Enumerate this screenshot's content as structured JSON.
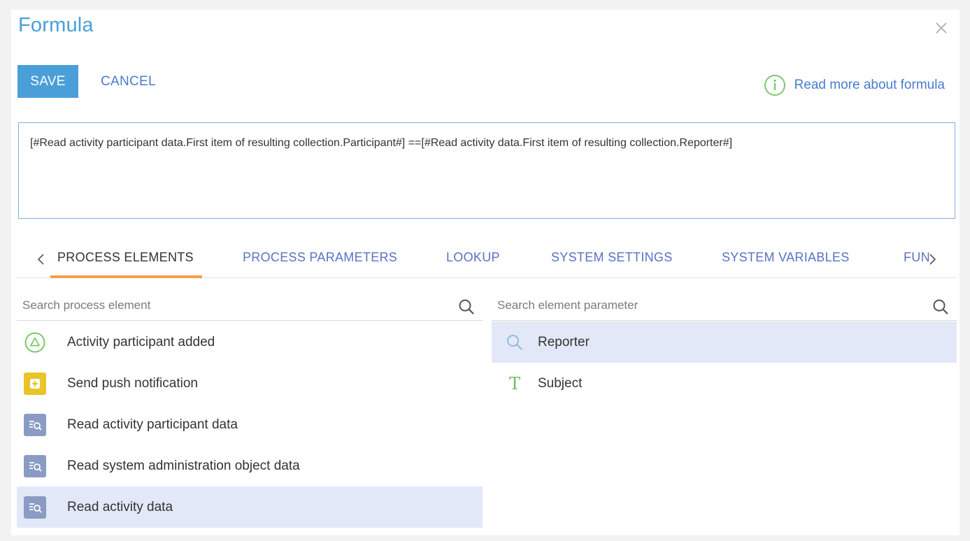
{
  "dialog": {
    "title": "Formula",
    "save_label": "SAVE",
    "cancel_label": "CANCEL",
    "read_more_label": "Read more about formula"
  },
  "formula": {
    "value": "[#Read activity participant data.First item of resulting collection.Participant#] ==[#Read activity data.First item of resulting collection.Reporter#]"
  },
  "tabs": [
    {
      "label": "PROCESS ELEMENTS",
      "active": true
    },
    {
      "label": "PROCESS PARAMETERS",
      "active": false
    },
    {
      "label": "LOOKUP",
      "active": false
    },
    {
      "label": "SYSTEM SETTINGS",
      "active": false
    },
    {
      "label": "SYSTEM VARIABLES",
      "active": false
    },
    {
      "label": "FUN",
      "active": false
    }
  ],
  "search": {
    "elements_placeholder": "Search process element",
    "parameters_placeholder": "Search element parameter"
  },
  "process_elements": [
    {
      "label": "Activity participant added",
      "icon": "start-signal-icon",
      "selected": false
    },
    {
      "label": "Send push notification",
      "icon": "push-notification-icon",
      "selected": false
    },
    {
      "label": "Read activity participant data",
      "icon": "read-data-icon",
      "selected": false
    },
    {
      "label": "Read system administration object data",
      "icon": "read-data-icon",
      "selected": false
    },
    {
      "label": "Read activity data",
      "icon": "read-data-icon",
      "selected": true
    }
  ],
  "element_parameters": [
    {
      "label": "Reporter",
      "icon": "lookup-icon",
      "selected": true
    },
    {
      "label": "Subject",
      "icon": "text-type-icon",
      "selected": false
    }
  ],
  "colors": {
    "accent": "#4a9fd8",
    "link": "#4a7bd0",
    "tab_underline": "#f39f4b",
    "selected_row": "#e2e8f7",
    "start_green": "#7cc86a",
    "push_yellow": "#e8c42a",
    "read_gray": "#8a9bc4"
  }
}
